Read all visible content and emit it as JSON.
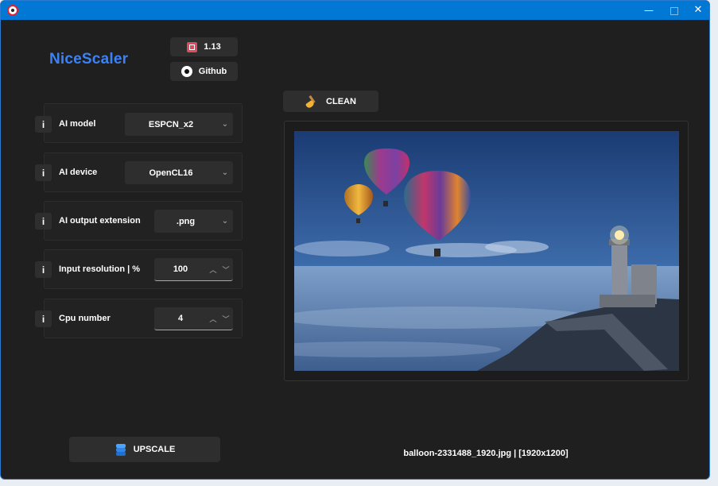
{
  "app": {
    "title": "NiceScaler"
  },
  "header": {
    "version_label": "1.13",
    "github_label": "Github"
  },
  "settings": {
    "ai_model": {
      "label": "AI model",
      "value": "ESPCN_x2"
    },
    "ai_device": {
      "label": "AI device",
      "value": "OpenCL16"
    },
    "ai_output_extension": {
      "label": "AI output extension",
      "value": ".png"
    },
    "input_resolution": {
      "label": "Input resolution | %",
      "value": "100"
    },
    "cpu_number": {
      "label": "Cpu number",
      "value": "4"
    },
    "info_label": "i"
  },
  "toolbar": {
    "clean_label": "CLEAN",
    "upscale_label": "UPSCALE"
  },
  "preview": {
    "file_info": "balloon-2331488_1920.jpg | [1920x1200]"
  },
  "colors": {
    "accent": "#3b82f6",
    "titlebar": "#0078d4",
    "background": "#1f1f1f",
    "button": "#2e2e2e"
  },
  "icons": {
    "version": "app-store-icon",
    "github": "github-icon",
    "clean": "broom-icon",
    "upscale": "layers-icon"
  }
}
